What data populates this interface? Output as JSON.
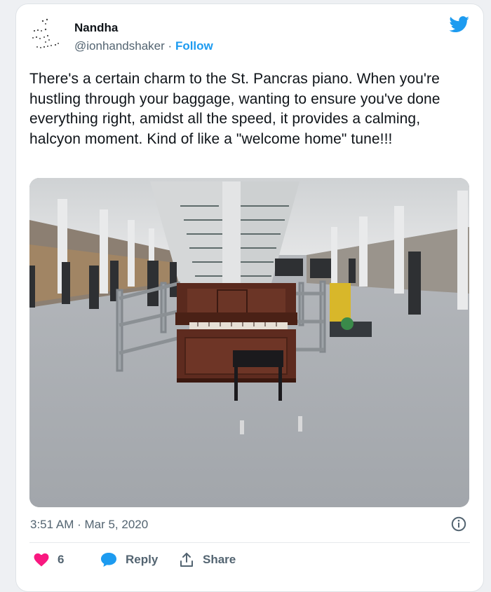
{
  "tweet": {
    "author": {
      "name": "Nandha",
      "handle": "@ionhandshaker",
      "separator": "·",
      "follow_label": "Follow",
      "avatar_icon": "dotted-doodle-avatar-icon"
    },
    "logo_icon": "twitter-bird-icon",
    "text": "There's a certain charm to the St. Pancras piano. When you're hustling through your baggage, wanting to ensure you've done everything right, amidst all the speed, it provides a calming, halcyon moment. Kind of like a \"welcome home\" tune!!!",
    "media": {
      "kind": "photo",
      "subject": "upright piano in station concourse"
    },
    "timestamp": "3:51 AM · Mar 5, 2020",
    "info_icon": "info-circle-icon",
    "actions": {
      "like": {
        "icon": "heart-icon",
        "count": "6"
      },
      "reply": {
        "icon": "speech-bubble-icon",
        "label": "Reply"
      },
      "share": {
        "icon": "share-arrow-icon",
        "label": "Share"
      }
    }
  },
  "colors": {
    "accent": "#1d9bf0",
    "like": "#f91880",
    "text": "#0f1419",
    "muted": "#536471"
  }
}
